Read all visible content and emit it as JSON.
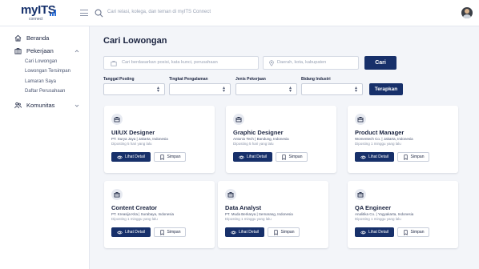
{
  "brand": {
    "logo_main": "myITS",
    "logo_sub": "connect",
    "primary": "#17306a",
    "accent": "#2d6fd6"
  },
  "topbar": {
    "search_placeholder": "Cari relasi, kolega, dan teman di myITS Connect"
  },
  "sidebar": {
    "beranda": "Beranda",
    "pekerjaan": "Pekerjaan",
    "pekerjaan_items": [
      "Cari Lowongan",
      "Lowongan Tersimpan",
      "Lamaran Saya",
      "Daftar Perusahaan"
    ],
    "komunitas": "Komunitas"
  },
  "main": {
    "title": "Cari Lowongan",
    "search_placeholder": "Cari berdasarkan posisi, kata kunci, perusahaan",
    "location_placeholder": "Daerah, kota, kabupaten",
    "search_button": "Cari",
    "filters": [
      "Tanggal Posting",
      "Tingkat Pengalaman",
      "Jenis Pekerjaan",
      "Bidang Industri"
    ],
    "apply_button": "Terapkan"
  },
  "jobs": [
    {
      "title": "UI/UX Designer",
      "meta": "PT. Surya Jaya  |  Jakarta, Indonesia",
      "time": "Diposting 5 hari yang lalu"
    },
    {
      "title": "Graphic Designer",
      "meta": "Antonio Tech  |  Bandung, Indonesia",
      "time": "Diposting 5 hari yang lalu"
    },
    {
      "title": "Product Manager",
      "meta": "Womentech Co.  |  Jakarta, Indonesia",
      "time": "Diposting 1 minggu yang lalu"
    },
    {
      "title": "Content Creator",
      "meta": "PT. Kreasija Kita  |  Surabaya, Indonesia",
      "time": "Diposting 1 minggu yang lalu"
    },
    {
      "title": "Data Analyst",
      "meta": "PT. Muda Berkarya  |  Semarang, Indonesia",
      "time": "Diposting 1 minggu yang lalu"
    },
    {
      "title": "QA Engineer",
      "meta": "Analitika Co.  |  Yogyakarta, Indonesia",
      "time": "Diposting 1 minggu yang lalu"
    }
  ],
  "card_actions": {
    "detail": "Lihat Detail",
    "save": "Simpan"
  }
}
